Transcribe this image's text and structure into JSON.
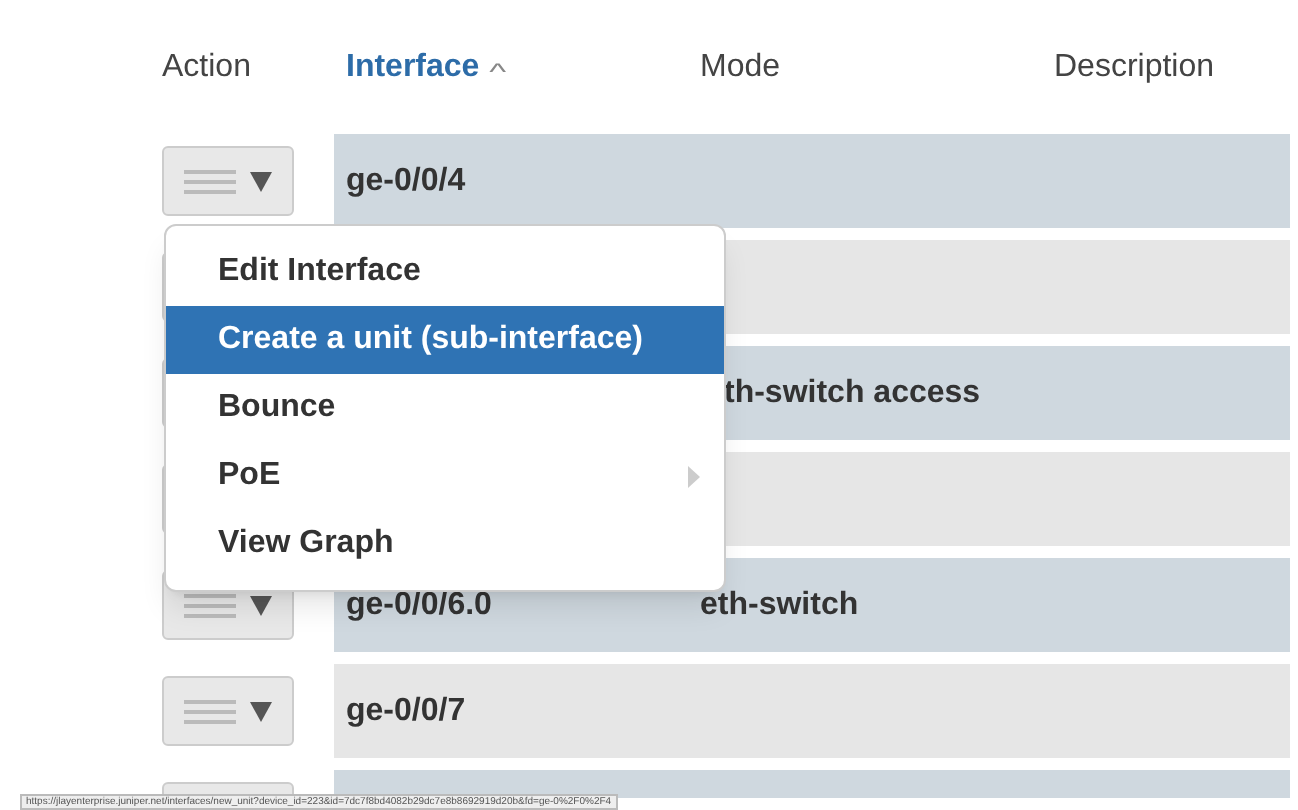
{
  "table": {
    "columns": [
      {
        "label": "Action",
        "sorted": false
      },
      {
        "label": "Interface",
        "sorted": true,
        "sort_icon": "^"
      },
      {
        "label": "Mode",
        "sorted": false
      },
      {
        "label": "Description",
        "sorted": false
      }
    ],
    "rows": [
      {
        "interface": "ge-0/0/4",
        "mode": ""
      },
      {
        "interface": "",
        "mode": ""
      },
      {
        "interface": "",
        "mode": "th-switch access"
      },
      {
        "interface": "",
        "mode": ""
      },
      {
        "interface": "ge-0/0/6.0",
        "mode": "eth-switch"
      },
      {
        "interface": "ge-0/0/7",
        "mode": ""
      },
      {
        "interface": "",
        "mode": ""
      }
    ]
  },
  "context_menu": {
    "items": [
      {
        "label": "Edit Interface",
        "selected": false,
        "submenu": false
      },
      {
        "label": "Create a unit (sub-interface)",
        "selected": true,
        "submenu": false
      },
      {
        "label": "Bounce",
        "selected": false,
        "submenu": false
      },
      {
        "label": "PoE",
        "selected": false,
        "submenu": true
      },
      {
        "label": "View Graph",
        "selected": false,
        "submenu": false
      }
    ]
  },
  "status_bar": {
    "url": "https://jlayenterprise.juniper.net/interfaces/new_unit?device_id=223&id=7dc7f8bd4082b29dc7e8b8692919d20b&fd=ge-0%2F0%2F4"
  }
}
